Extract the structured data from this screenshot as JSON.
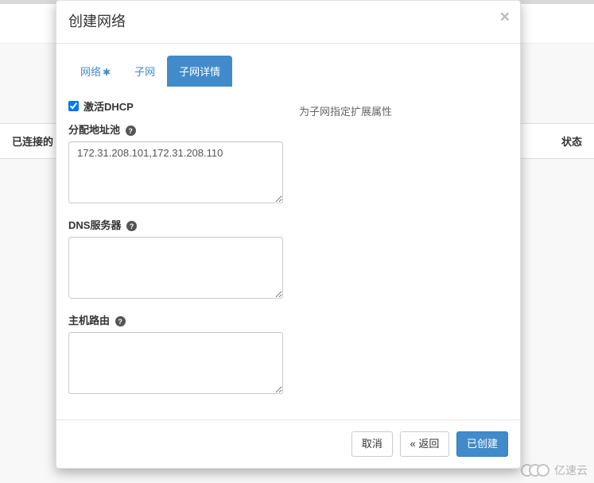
{
  "modal": {
    "title": "创建网络",
    "close_label": "×"
  },
  "tabs": [
    {
      "label": "网络",
      "required": true
    },
    {
      "label": "子网",
      "required": false
    },
    {
      "label": "子网详情",
      "required": false
    }
  ],
  "form": {
    "dhcp": {
      "label": "激活DHCP",
      "checked": true
    },
    "allocation_pools": {
      "label": "分配地址池",
      "value": "172.31.208.101,172.31.208.110"
    },
    "dns_servers": {
      "label": "DNS服务器",
      "value": ""
    },
    "host_routes": {
      "label": "主机路由",
      "value": ""
    },
    "description": "为子网指定扩展属性"
  },
  "footer": {
    "cancel": "取消",
    "back": "« 返回",
    "submit": "已创建"
  },
  "background": {
    "col_left": "已连接的",
    "col_right": "状态"
  },
  "watermark": {
    "text": "亿速云"
  }
}
